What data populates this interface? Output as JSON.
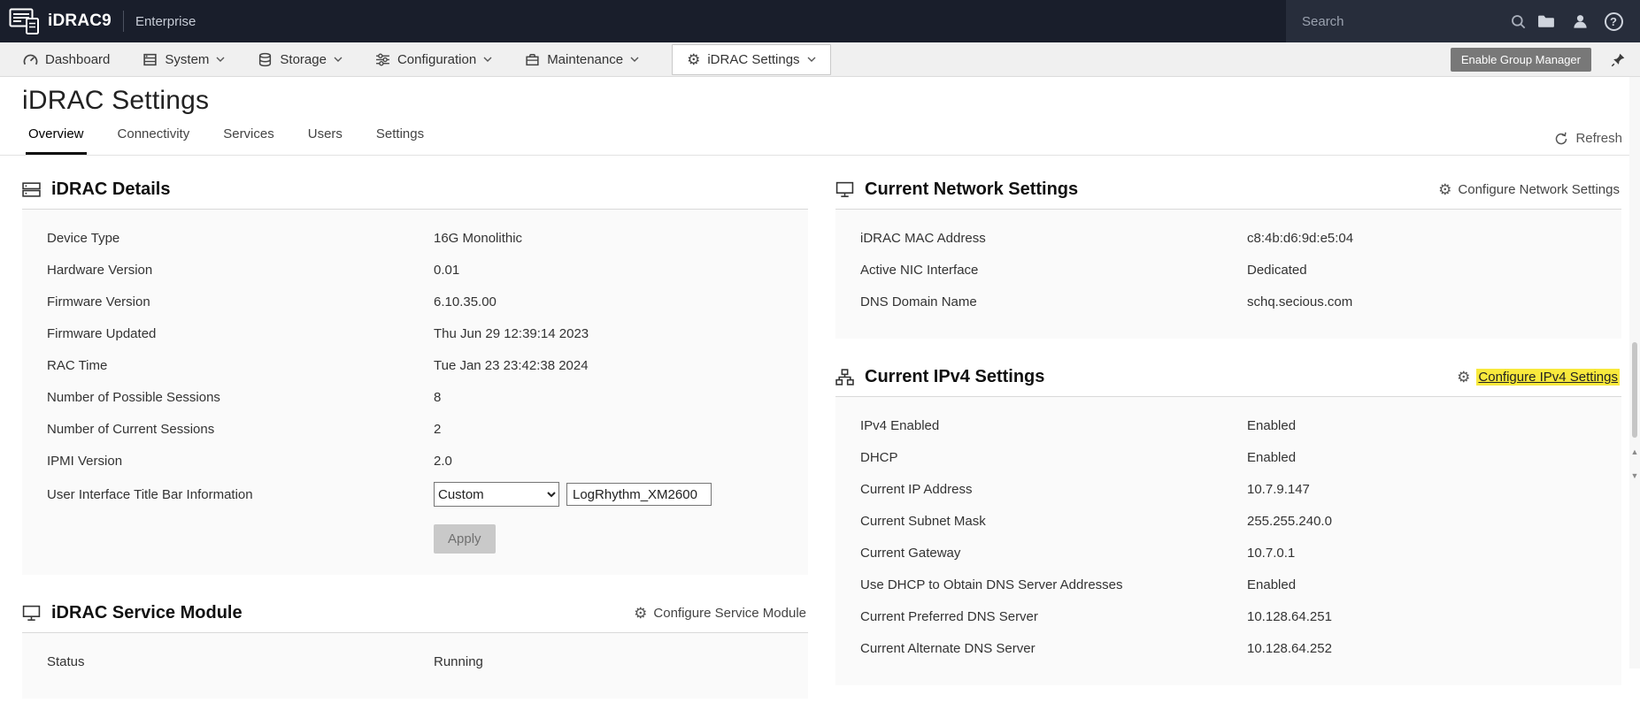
{
  "colors": {
    "masthead_bg": "#191e2b",
    "masthead_right_bg": "#272d3b",
    "nav_bg": "#f0f0f0",
    "active_tab_underline": "#111111",
    "group_manager_button": "#787878",
    "find_highlight": "#f8e93c",
    "card_body_bg": "#fafafa"
  },
  "masthead": {
    "brand": "iDRAC9",
    "edition": "Enterprise",
    "search_placeholder": "Search",
    "icons": [
      "folder-icon",
      "user-icon",
      "help-icon"
    ]
  },
  "nav": {
    "items": [
      {
        "label": "Dashboard",
        "icon": "dashboard-icon",
        "dropdown": false,
        "active": false
      },
      {
        "label": "System",
        "icon": "system-icon",
        "dropdown": true,
        "active": false
      },
      {
        "label": "Storage",
        "icon": "storage-icon",
        "dropdown": true,
        "active": false
      },
      {
        "label": "Configuration",
        "icon": "configuration-icon",
        "dropdown": true,
        "active": false
      },
      {
        "label": "Maintenance",
        "icon": "maintenance-icon",
        "dropdown": true,
        "active": false
      },
      {
        "label": "iDRAC Settings",
        "icon": "gear-icon",
        "dropdown": true,
        "active": true
      }
    ],
    "enable_group_manager_label": "Enable Group Manager"
  },
  "page": {
    "title": "iDRAC Settings",
    "tabs": [
      {
        "label": "Overview",
        "active": true
      },
      {
        "label": "Connectivity",
        "active": false
      },
      {
        "label": "Services",
        "active": false
      },
      {
        "label": "Users",
        "active": false
      },
      {
        "label": "Settings",
        "active": false
      }
    ],
    "refresh_label": "Refresh"
  },
  "idrac_details": {
    "title": "iDRAC Details",
    "rows": [
      {
        "label": "Device Type",
        "value": "16G Monolithic"
      },
      {
        "label": "Hardware Version",
        "value": "0.01"
      },
      {
        "label": "Firmware Version",
        "value": "6.10.35.00"
      },
      {
        "label": "Firmware Updated",
        "value": "Thu Jun 29 12:39:14 2023"
      },
      {
        "label": "RAC Time",
        "value": "Tue Jan 23 23:42:38 2024"
      },
      {
        "label": "Number of Possible Sessions",
        "value": "8"
      },
      {
        "label": "Number of Current Sessions",
        "value": "2"
      },
      {
        "label": "IPMI Version",
        "value": "2.0"
      }
    ],
    "title_bar": {
      "label": "User Interface Title Bar Information",
      "select_value": "Custom",
      "input_value": "LogRhythm_XM2600"
    },
    "apply_label": "Apply"
  },
  "service_module": {
    "title": "iDRAC Service Module",
    "configure_label": "Configure Service Module",
    "rows": [
      {
        "label": "Status",
        "value": "Running"
      }
    ]
  },
  "network_settings": {
    "title": "Current Network Settings",
    "configure_label": "Configure Network Settings",
    "rows": [
      {
        "label": "iDRAC MAC Address",
        "value": "c8:4b:d6:9d:e5:04"
      },
      {
        "label": "Active NIC Interface",
        "value": "Dedicated"
      },
      {
        "label": "DNS Domain Name",
        "value": "schq.secious.com"
      }
    ]
  },
  "ipv4_settings": {
    "title": "Current IPv4 Settings",
    "configure_label": "Configure IPv4 Settings",
    "configure_highlighted": true,
    "rows": [
      {
        "label": "IPv4 Enabled",
        "value": "Enabled"
      },
      {
        "label": "DHCP",
        "value": "Enabled"
      },
      {
        "label": "Current IP Address",
        "value": "10.7.9.147"
      },
      {
        "label": "Current Subnet Mask",
        "value": "255.255.240.0"
      },
      {
        "label": "Current Gateway",
        "value": "10.7.0.1"
      },
      {
        "label": "Use DHCP to Obtain DNS Server Addresses",
        "value": "Enabled"
      },
      {
        "label": "Current Preferred DNS Server",
        "value": "10.128.64.251"
      },
      {
        "label": "Current Alternate DNS Server",
        "value": "10.128.64.252"
      }
    ]
  }
}
